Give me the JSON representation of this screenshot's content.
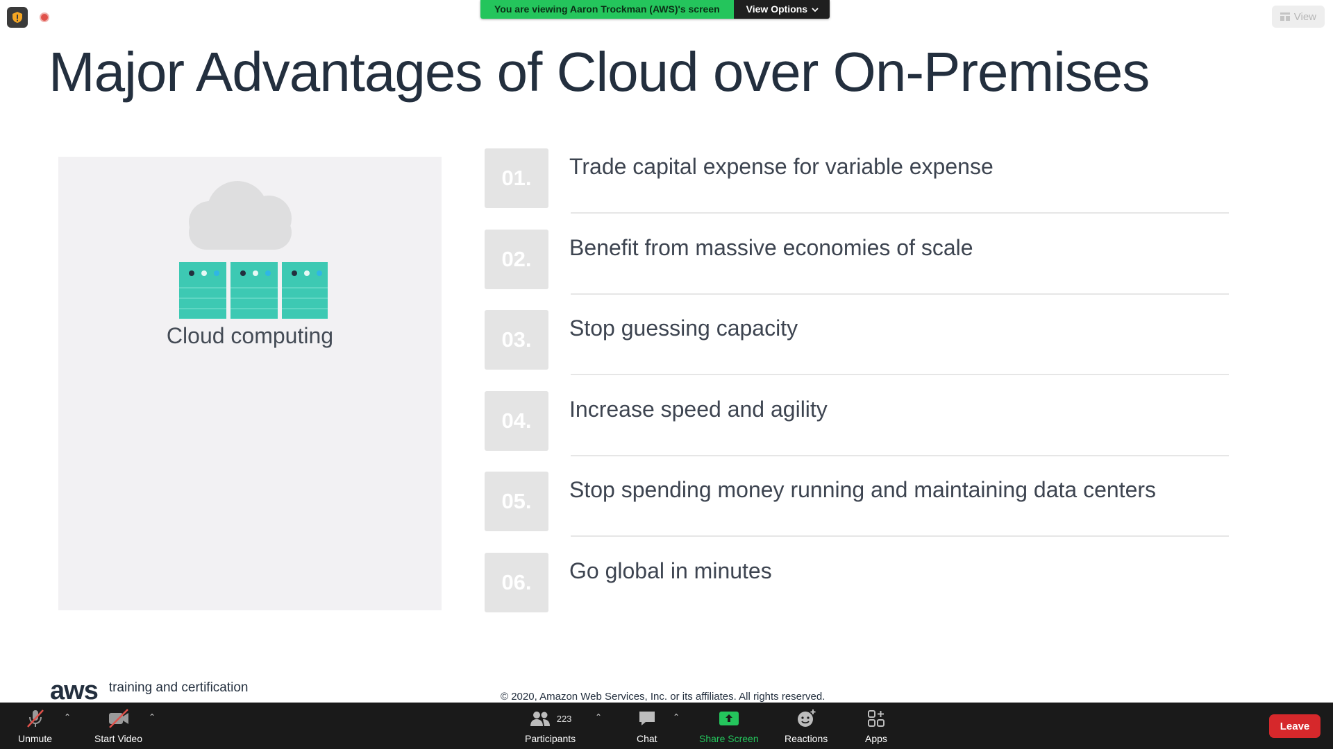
{
  "overlay": {
    "share_message": "You are viewing Aaron Trockman (AWS)'s screen",
    "view_options": "View Options",
    "view_button": "View"
  },
  "slide": {
    "title": "Major Advantages of Cloud over On-Premises",
    "panel_caption": "Cloud computing",
    "advantages": [
      {
        "num": "01.",
        "text": "Trade capital expense for variable expense"
      },
      {
        "num": "02.",
        "text": "Benefit from massive economies of scale"
      },
      {
        "num": "03.",
        "text": "Stop guessing capacity"
      },
      {
        "num": "04.",
        "text": "Increase speed and agility"
      },
      {
        "num": "05.",
        "text": "Stop spending money running and maintaining data centers"
      },
      {
        "num": "06.",
        "text": "Go global in minutes"
      }
    ],
    "logo_word": "aws",
    "logo_tagline": "training and certification",
    "copyright": "© 2020, Amazon Web Services, Inc. or its affiliates. All rights reserved."
  },
  "toolbar": {
    "unmute": "Unmute",
    "start_video": "Start Video",
    "participants": "Participants",
    "participant_count": "223",
    "chat": "Chat",
    "share_screen": "Share Screen",
    "reactions": "Reactions",
    "apps": "Apps",
    "leave": "Leave"
  },
  "colors": {
    "accent_green": "#24c55c",
    "leave_red": "#d6282b",
    "server_teal": "#3dc9b3",
    "title_navy": "#232f3e"
  }
}
